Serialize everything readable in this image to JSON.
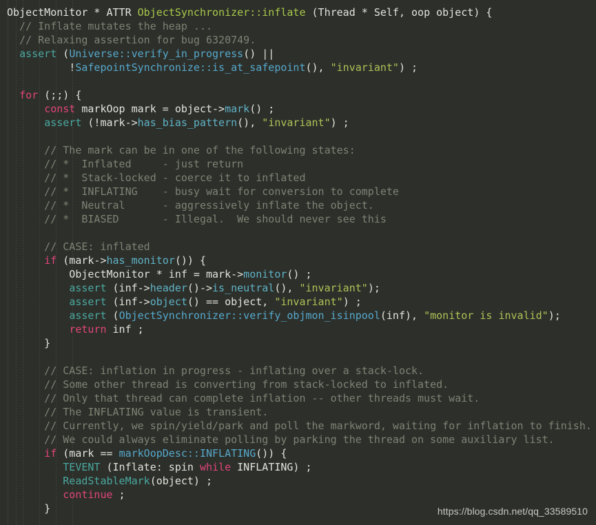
{
  "editor": {
    "language": "cpp",
    "background_color": "#2d2f2a",
    "default_text_color": "#e3e3dc",
    "font_size_px": 15,
    "line_height_px": 20,
    "total_lines": 37
  },
  "theme": {
    "comment_color": "#7d8374",
    "keyword_color": "#e0457b",
    "function_color": "#a8c94b",
    "string_color": "#b0c257",
    "member_call_color": "#5fb3c7",
    "assert_color": "#4aa8a0",
    "scope_color": "#56a9cc",
    "plain_color": "#e3e3dc"
  },
  "watermark": {
    "text": "https://blog.csdn.net/qq_33589510",
    "color": "#c7c7c2"
  },
  "code": {
    "lines": [
      {
        "n": 1,
        "text": "ObjectMonitor * ATTR ObjectSynchronizer::inflate (Thread * Self, oop object) {",
        "spans": [
          {
            "cls": "t-plain",
            "text": "ObjectMonitor * ATTR "
          },
          {
            "cls": "t-fn",
            "text": "ObjectSynchronizer::inflate"
          },
          {
            "cls": "t-plain",
            "text": " (Thread * Self, oop object) {"
          }
        ]
      },
      {
        "n": 2,
        "text": "  // Inflate mutates the heap ...",
        "spans": [
          {
            "cls": "t-comment",
            "text": "  // Inflate mutates the heap ..."
          }
        ]
      },
      {
        "n": 3,
        "text": "  // Relaxing assertion for bug 6320749.",
        "spans": [
          {
            "cls": "t-comment",
            "text": "  // Relaxing assertion for bug 6320749."
          }
        ]
      },
      {
        "n": 4,
        "text": "  assert (Universe::verify_in_progress() ||",
        "spans": [
          {
            "cls": "t-plain",
            "text": "  "
          },
          {
            "cls": "t-assert",
            "text": "assert"
          },
          {
            "cls": "t-plain",
            "text": " ("
          },
          {
            "cls": "t-scope",
            "text": "Universe::verify_in_progress"
          },
          {
            "cls": "t-plain",
            "text": "() ||"
          }
        ]
      },
      {
        "n": 5,
        "text": "          !SafepointSynchronize::is_at_safepoint(), \"invariant\") ;",
        "spans": [
          {
            "cls": "t-plain",
            "text": "          !"
          },
          {
            "cls": "t-scope",
            "text": "SafepointSynchronize::is_at_safepoint"
          },
          {
            "cls": "t-plain",
            "text": "(), "
          },
          {
            "cls": "t-str",
            "text": "\"invariant\""
          },
          {
            "cls": "t-plain",
            "text": ") ;"
          }
        ]
      },
      {
        "n": 6,
        "text": "",
        "spans": []
      },
      {
        "n": 7,
        "text": "  for (;;) {",
        "spans": [
          {
            "cls": "t-plain",
            "text": "  "
          },
          {
            "cls": "t-kw",
            "text": "for"
          },
          {
            "cls": "t-plain",
            "text": " (;;) {"
          }
        ]
      },
      {
        "n": 8,
        "text": "      const markOop mark = object->mark() ;",
        "spans": [
          {
            "cls": "t-plain",
            "text": "      "
          },
          {
            "cls": "t-kw",
            "text": "const"
          },
          {
            "cls": "t-plain",
            "text": " markOop mark = object->"
          },
          {
            "cls": "t-call",
            "text": "mark"
          },
          {
            "cls": "t-plain",
            "text": "() ;"
          }
        ]
      },
      {
        "n": 9,
        "text": "      assert (!mark->has_bias_pattern(), \"invariant\") ;",
        "spans": [
          {
            "cls": "t-plain",
            "text": "      "
          },
          {
            "cls": "t-assert",
            "text": "assert"
          },
          {
            "cls": "t-plain",
            "text": " (!mark->"
          },
          {
            "cls": "t-call",
            "text": "has_bias_pattern"
          },
          {
            "cls": "t-plain",
            "text": "(), "
          },
          {
            "cls": "t-str",
            "text": "\"invariant\""
          },
          {
            "cls": "t-plain",
            "text": ") ;"
          }
        ]
      },
      {
        "n": 10,
        "text": "",
        "spans": []
      },
      {
        "n": 11,
        "text": "      // The mark can be in one of the following states:",
        "spans": [
          {
            "cls": "t-comment",
            "text": "      // The mark can be in one of the following states:"
          }
        ]
      },
      {
        "n": 12,
        "text": "      // *  Inflated     - just return",
        "spans": [
          {
            "cls": "t-comment",
            "text": "      // *  Inflated     - just return"
          }
        ]
      },
      {
        "n": 13,
        "text": "      // *  Stack-locked - coerce it to inflated",
        "spans": [
          {
            "cls": "t-comment",
            "text": "      // *  Stack-locked - coerce it to inflated"
          }
        ]
      },
      {
        "n": 14,
        "text": "      // *  INFLATING    - busy wait for conversion to complete",
        "spans": [
          {
            "cls": "t-comment",
            "text": "      // *  INFLATING    - busy wait for conversion to complete"
          }
        ]
      },
      {
        "n": 15,
        "text": "      // *  Neutral      - aggressively inflate the object.",
        "spans": [
          {
            "cls": "t-comment",
            "text": "      // *  Neutral      - aggressively inflate the object."
          }
        ]
      },
      {
        "n": 16,
        "text": "      // *  BIASED       - Illegal.  We should never see this",
        "spans": [
          {
            "cls": "t-comment",
            "text": "      // *  BIASED       - Illegal.  We should never see this"
          }
        ]
      },
      {
        "n": 17,
        "text": "",
        "spans": []
      },
      {
        "n": 18,
        "text": "      // CASE: inflated",
        "spans": [
          {
            "cls": "t-comment",
            "text": "      // CASE: inflated"
          }
        ]
      },
      {
        "n": 19,
        "text": "      if (mark->has_monitor()) {",
        "spans": [
          {
            "cls": "t-plain",
            "text": "      "
          },
          {
            "cls": "t-kw",
            "text": "if"
          },
          {
            "cls": "t-plain",
            "text": " (mark->"
          },
          {
            "cls": "t-call",
            "text": "has_monitor"
          },
          {
            "cls": "t-plain",
            "text": "()) {"
          }
        ]
      },
      {
        "n": 20,
        "text": "          ObjectMonitor * inf = mark->monitor() ;",
        "spans": [
          {
            "cls": "t-plain",
            "text": "          ObjectMonitor * inf = mark->"
          },
          {
            "cls": "t-call",
            "text": "monitor"
          },
          {
            "cls": "t-plain",
            "text": "() ;"
          }
        ]
      },
      {
        "n": 21,
        "text": "          assert (inf->header()->is_neutral(), \"invariant\");",
        "spans": [
          {
            "cls": "t-plain",
            "text": "          "
          },
          {
            "cls": "t-assert",
            "text": "assert"
          },
          {
            "cls": "t-plain",
            "text": " (inf->"
          },
          {
            "cls": "t-call",
            "text": "header"
          },
          {
            "cls": "t-plain",
            "text": "()->"
          },
          {
            "cls": "t-call",
            "text": "is_neutral"
          },
          {
            "cls": "t-plain",
            "text": "(), "
          },
          {
            "cls": "t-str",
            "text": "\"invariant\""
          },
          {
            "cls": "t-plain",
            "text": ");"
          }
        ]
      },
      {
        "n": 22,
        "text": "          assert (inf->object() == object, \"invariant\") ;",
        "spans": [
          {
            "cls": "t-plain",
            "text": "          "
          },
          {
            "cls": "t-assert",
            "text": "assert"
          },
          {
            "cls": "t-plain",
            "text": " (inf->"
          },
          {
            "cls": "t-call",
            "text": "object"
          },
          {
            "cls": "t-plain",
            "text": "() == object, "
          },
          {
            "cls": "t-str",
            "text": "\"invariant\""
          },
          {
            "cls": "t-plain",
            "text": ") ;"
          }
        ]
      },
      {
        "n": 23,
        "text": "          assert (ObjectSynchronizer::verify_objmon_isinpool(inf), \"monitor is invalid\");",
        "spans": [
          {
            "cls": "t-plain",
            "text": "          "
          },
          {
            "cls": "t-assert",
            "text": "assert"
          },
          {
            "cls": "t-plain",
            "text": " ("
          },
          {
            "cls": "t-scope",
            "text": "ObjectSynchronizer::verify_objmon_isinpool"
          },
          {
            "cls": "t-plain",
            "text": "(inf), "
          },
          {
            "cls": "t-str",
            "text": "\"monitor is invalid\""
          },
          {
            "cls": "t-plain",
            "text": ");"
          }
        ]
      },
      {
        "n": 24,
        "text": "          return inf ;",
        "spans": [
          {
            "cls": "t-plain",
            "text": "          "
          },
          {
            "cls": "t-kw",
            "text": "return"
          },
          {
            "cls": "t-plain",
            "text": " inf ;"
          }
        ]
      },
      {
        "n": 25,
        "text": "      }",
        "spans": [
          {
            "cls": "t-plain",
            "text": "      }"
          }
        ]
      },
      {
        "n": 26,
        "text": "",
        "spans": []
      },
      {
        "n": 27,
        "text": "      // CASE: inflation in progress - inflating over a stack-lock.",
        "spans": [
          {
            "cls": "t-comment",
            "text": "      // CASE: inflation in progress - inflating over a stack-lock."
          }
        ]
      },
      {
        "n": 28,
        "text": "      // Some other thread is converting from stack-locked to inflated.",
        "spans": [
          {
            "cls": "t-comment",
            "text": "      // Some other thread is converting from stack-locked to inflated."
          }
        ]
      },
      {
        "n": 29,
        "text": "      // Only that thread can complete inflation -- other threads must wait.",
        "spans": [
          {
            "cls": "t-comment",
            "text": "      // Only that thread can complete inflation -- other threads must wait."
          }
        ]
      },
      {
        "n": 30,
        "text": "      // The INFLATING value is transient.",
        "spans": [
          {
            "cls": "t-comment",
            "text": "      // The INFLATING value is transient."
          }
        ]
      },
      {
        "n": 31,
        "text": "      // Currently, we spin/yield/park and poll the markword, waiting for inflation to finish.",
        "spans": [
          {
            "cls": "t-comment",
            "text": "      // Currently, we spin/yield/park and poll the markword, waiting for inflation to finish."
          }
        ]
      },
      {
        "n": 32,
        "text": "      // We could always eliminate polling by parking the thread on some auxiliary list.",
        "spans": [
          {
            "cls": "t-comment",
            "text": "      // We could always eliminate polling by parking the thread on some auxiliary list."
          }
        ]
      },
      {
        "n": 33,
        "text": "      if (mark == markOopDesc::INFLATING()) {",
        "spans": [
          {
            "cls": "t-plain",
            "text": "      "
          },
          {
            "cls": "t-kw",
            "text": "if"
          },
          {
            "cls": "t-plain",
            "text": " (mark == "
          },
          {
            "cls": "t-scope",
            "text": "markOopDesc::INFLATING"
          },
          {
            "cls": "t-plain",
            "text": "()) {"
          }
        ]
      },
      {
        "n": 34,
        "text": "         TEVENT (Inflate: spin while INFLATING) ;",
        "spans": [
          {
            "cls": "t-plain",
            "text": "         "
          },
          {
            "cls": "t-assert",
            "text": "TEVENT"
          },
          {
            "cls": "t-plain",
            "text": " (Inflate: spin "
          },
          {
            "cls": "t-kw",
            "text": "while"
          },
          {
            "cls": "t-plain",
            "text": " INFLATING) ;"
          }
        ]
      },
      {
        "n": 35,
        "text": "         ReadStableMark(object) ;",
        "spans": [
          {
            "cls": "t-plain",
            "text": "         "
          },
          {
            "cls": "t-assert",
            "text": "ReadStableMark"
          },
          {
            "cls": "t-plain",
            "text": "(object) ;"
          }
        ]
      },
      {
        "n": 36,
        "text": "         continue ;",
        "spans": [
          {
            "cls": "t-plain",
            "text": "         "
          },
          {
            "cls": "t-kw",
            "text": "continue"
          },
          {
            "cls": "t-plain",
            "text": " ;"
          }
        ]
      },
      {
        "n": 37,
        "text": "      }",
        "spans": [
          {
            "cls": "t-plain",
            "text": "      }"
          }
        ]
      }
    ]
  },
  "indent_guides": {
    "x_positions": [
      11,
      23,
      33,
      57,
      81,
      105
    ]
  }
}
